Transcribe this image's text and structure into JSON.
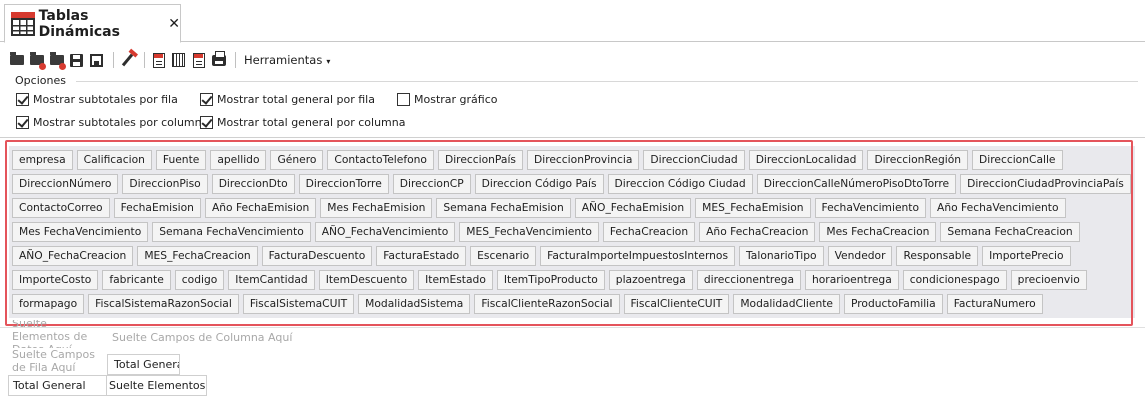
{
  "tab": {
    "title": "Tablas Dinámicas",
    "close": "✕"
  },
  "toolbar": {
    "icons": [
      "open-folder-icon",
      "open-layout-icon",
      "delete-layout-icon",
      "save-icon",
      "save-as-icon",
      "wand-icon",
      "export-excel-icon",
      "export-csv-icon",
      "export-pdf-icon",
      "print-icon"
    ],
    "menu_label": "Herramientas",
    "menu_caret": "▾"
  },
  "options": {
    "title": "Opciones",
    "items": [
      {
        "label": "Mostrar subtotales por fila",
        "checked": true
      },
      {
        "label": "Mostrar total general por fila",
        "checked": true
      },
      {
        "label": "Mostrar gráfico",
        "checked": false
      },
      {
        "label": "Mostrar subtotales por columna",
        "checked": true
      },
      {
        "label": "Mostrar total general por columna",
        "checked": true
      }
    ]
  },
  "fields": {
    "rows": [
      [
        "empresa",
        "Calificacion",
        "Fuente",
        "apellido",
        "Género",
        "ContactoTelefono",
        "DireccionPaís",
        "DireccionProvincia",
        "DireccionCiudad",
        "DireccionLocalidad",
        "DireccionRegión",
        "DireccionCalle"
      ],
      [
        "DireccionNúmero",
        "DireccionPiso",
        "DireccionDto",
        "DireccionTorre",
        "DireccionCP",
        "Direccion Código País",
        "Direccion Código Ciudad",
        "DireccionCalleNúmeroPisoDtoTorre",
        "DireccionCiudadProvinciaPaís"
      ],
      [
        "ContactoCorreo",
        "FechaEmision",
        "Año FechaEmision",
        "Mes FechaEmision",
        "Semana FechaEmision",
        "AÑO_FechaEmision",
        "MES_FechaEmision",
        "FechaVencimiento",
        "Año FechaVencimiento"
      ],
      [
        "Mes FechaVencimiento",
        "Semana FechaVencimiento",
        "AÑO_FechaVencimiento",
        "MES_FechaVencimiento",
        "FechaCreacion",
        "Año FechaCreacion",
        "Mes FechaCreacion",
        "Semana FechaCreacion"
      ],
      [
        "AÑO_FechaCreacion",
        "MES_FechaCreacion",
        "FacturaDescuento",
        "FacturaEstado",
        "Escenario",
        "FacturaImporteImpuestosInternos",
        "TalonarioTipo",
        "Vendedor",
        "Responsable",
        "ImportePrecio"
      ],
      [
        "ImporteCosto",
        "fabricante",
        "codigo",
        "ItemCantidad",
        "ItemDescuento",
        "ItemEstado",
        "ItemTipoProducto",
        "plazoentrega",
        "direccionentrega",
        "horarioentrega",
        "condicionespago",
        "precioenvio"
      ],
      [
        "formapago",
        "FiscalSistemaRazonSocial",
        "FiscalSistemaCUIT",
        "ModalidadSistema",
        "FiscalClienteRazonSocial",
        "FiscalClienteCUIT",
        "ModalidadCliente",
        "ProductoFamilia",
        "FacturaNumero"
      ]
    ]
  },
  "pivot": {
    "data_zone": "Suelte Elementos de Datos Aquí",
    "column_zone": "Suelte Campos de Columna Aquí",
    "row_zone": "Suelte Campos de Fila Aquí",
    "column_header_total": "Total General",
    "row_total": "Total General",
    "data_cell": "Suelte Elementos de"
  }
}
